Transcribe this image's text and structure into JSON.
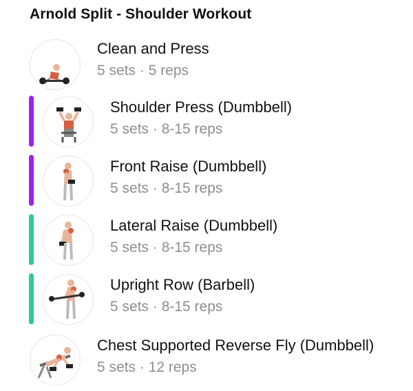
{
  "workout": {
    "title": "Arnold Split - Shoulder Workout"
  },
  "colors": {
    "superset_purple": "#A020F0",
    "superset_green": "#2ECC8A"
  },
  "exercises": [
    {
      "name": "Clean and Press",
      "meta": "5 sets · 5 reps",
      "icon": "clean-and-press-figure"
    },
    {
      "name": "Shoulder Press (Dumbbell)",
      "meta": "5 sets · 8-15 reps",
      "icon": "shoulder-press-figure",
      "superset_color": "#A020F0"
    },
    {
      "name": "Front Raise (Dumbbell)",
      "meta": "5 sets · 8-15 reps",
      "icon": "front-raise-figure",
      "superset_color": "#A020F0"
    },
    {
      "name": "Lateral Raise (Dumbbell)",
      "meta": "5 sets · 8-15 reps",
      "icon": "lateral-raise-figure",
      "superset_color": "#2ECC8A"
    },
    {
      "name": "Upright Row (Barbell)",
      "meta": "5 sets · 8-15 reps",
      "icon": "upright-row-figure",
      "superset_color": "#2ECC8A"
    },
    {
      "name": "Chest Supported Reverse Fly (Dumbbell)",
      "meta": "5 sets · 12 reps",
      "icon": "reverse-fly-figure"
    }
  ]
}
